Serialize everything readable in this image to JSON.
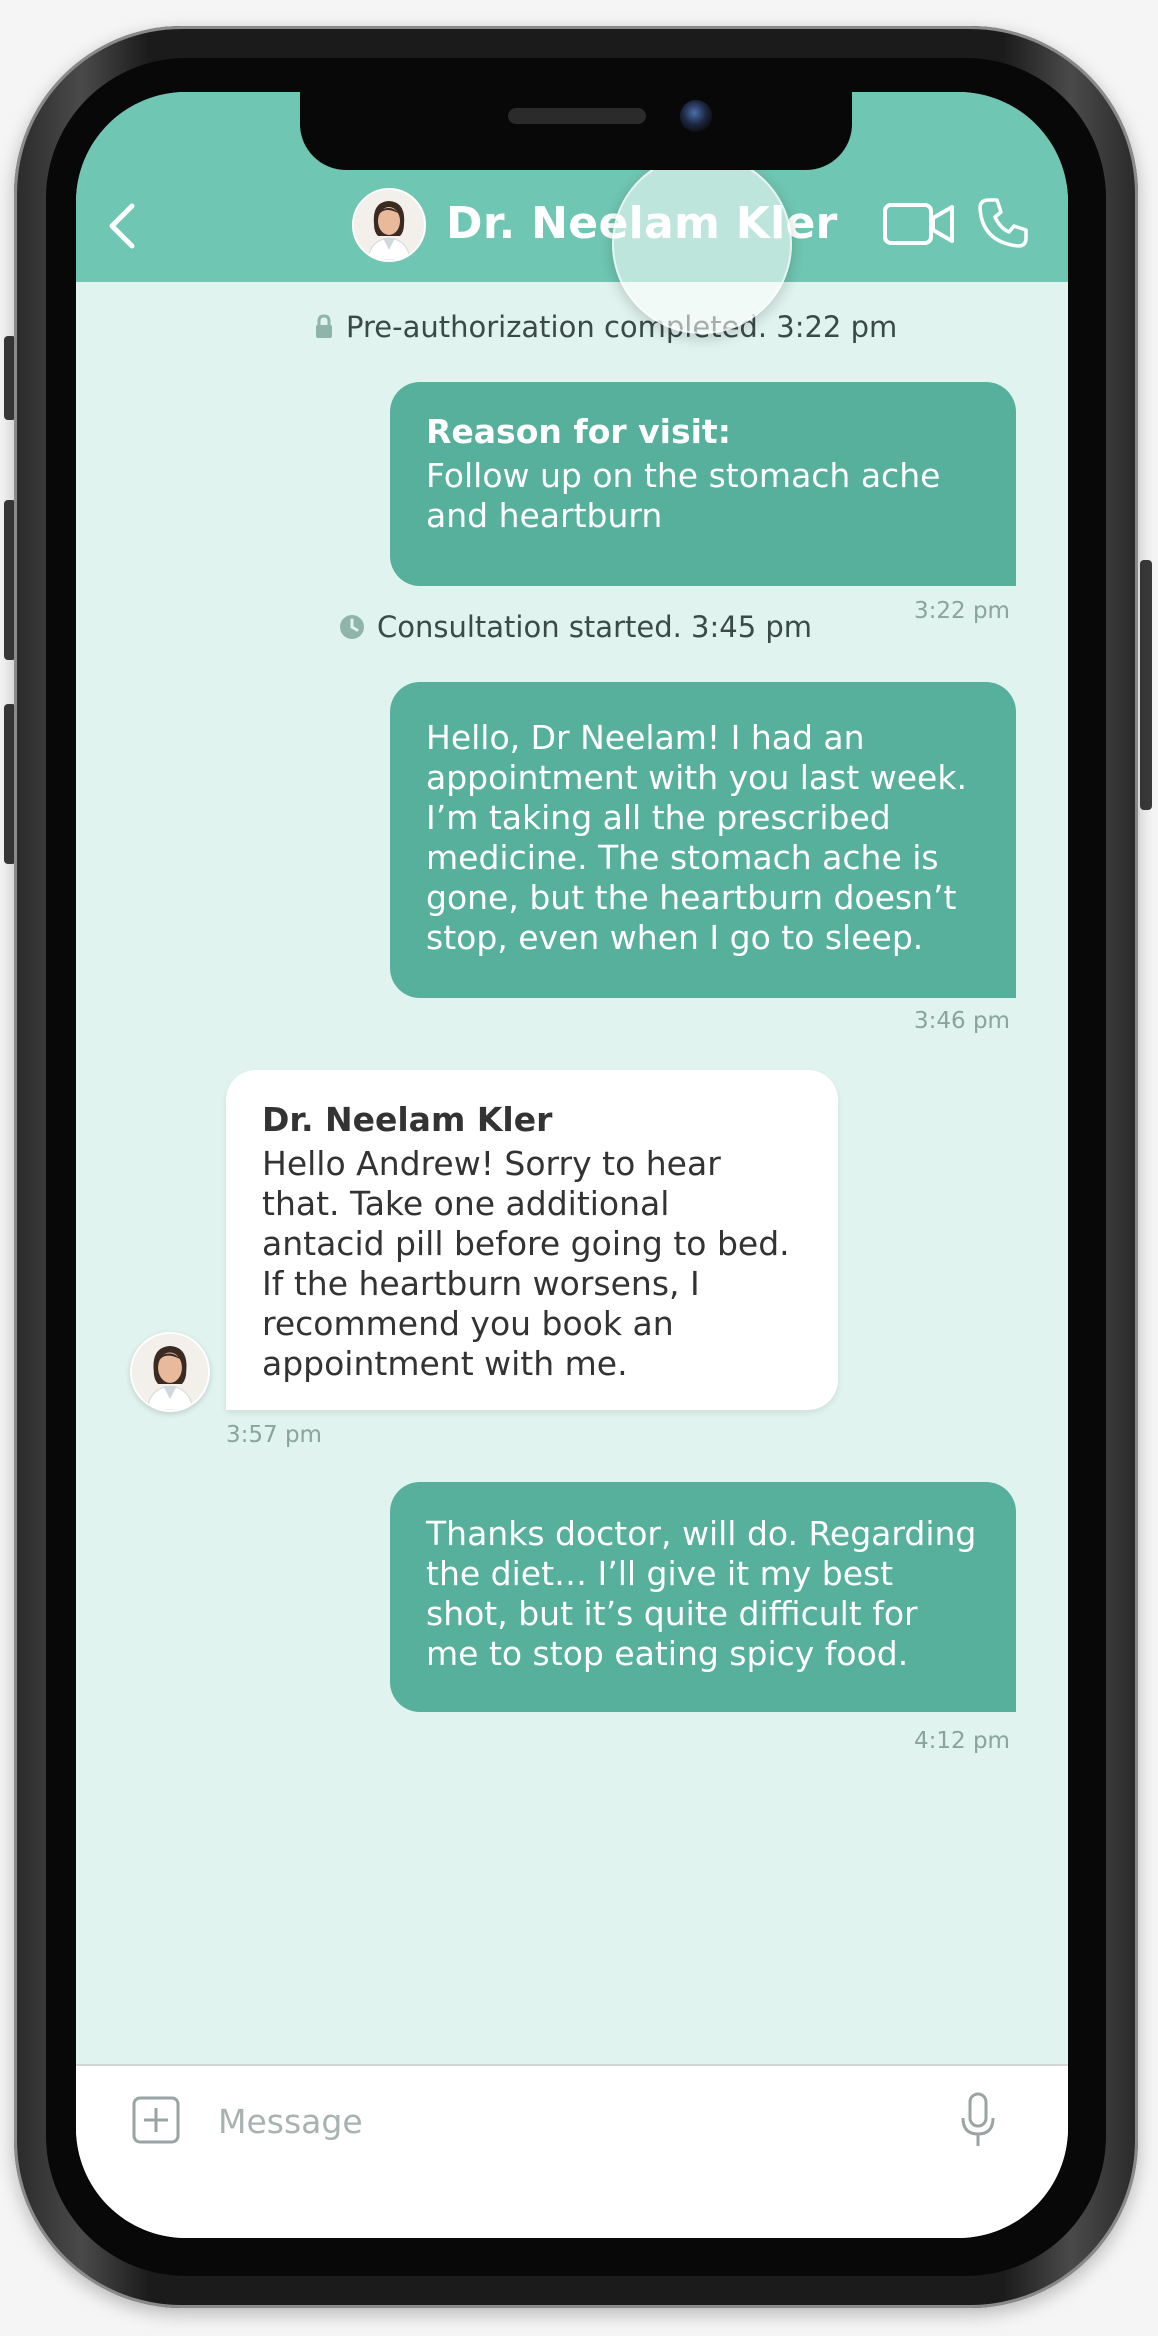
{
  "colors": {
    "header": "#6fc6b2",
    "chat_background": "#e0f3ee",
    "outgoing_bubble": "#56b09c",
    "incoming_bubble": "#ffffff",
    "timestamp": "#8aa39d"
  },
  "header": {
    "contact_name": "Dr. Neelam Kler",
    "back_icon": "chevron-left-icon",
    "video_icon": "video-camera-icon",
    "call_icon": "phone-icon"
  },
  "system_messages": {
    "preauth": {
      "icon": "lock-icon",
      "text": "Pre-authorization completed. 3:22 pm"
    },
    "consultation": {
      "icon": "clock-icon",
      "text": "Consultation started. 3:45 pm"
    }
  },
  "messages": [
    {
      "direction": "outgoing",
      "heading": "Reason for visit:",
      "text": "Follow up on the stomach ache and heartburn",
      "time": "3:22 pm"
    },
    {
      "direction": "outgoing",
      "text": "Hello, Dr Neelam! I had an appointment with you last week. I’m taking all the prescribed medicine. The stomach ache is gone, but the heartburn doesn’t stop, even when I go to sleep.",
      "time": "3:46 pm"
    },
    {
      "direction": "incoming",
      "sender": "Dr. Neelam Kler",
      "text": "Hello Andrew! Sorry to hear that. Take one additional antacid pill before going to bed. If the heartburn worsens, I recommend you book an appointment with me.",
      "time": "3:57 pm"
    },
    {
      "direction": "outgoing",
      "text": "Thanks doctor, will do. Regarding the diet… I’ll give it my best shot, but it’s quite difficult for me to stop eating spicy food.",
      "time": "4:12 pm"
    }
  ],
  "composer": {
    "placeholder": "Message",
    "value": "",
    "attach_icon": "plus-square-icon",
    "mic_icon": "microphone-icon"
  }
}
